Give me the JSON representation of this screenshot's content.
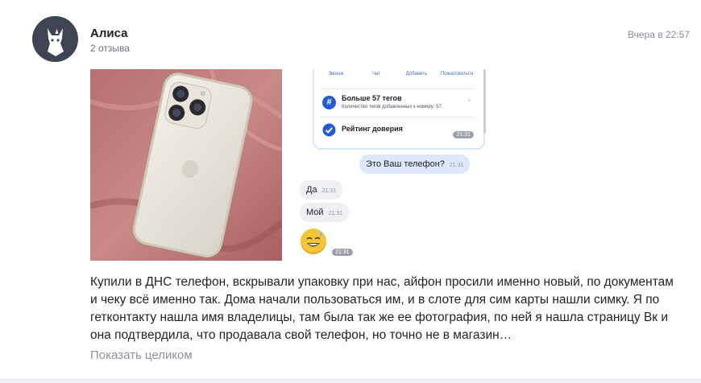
{
  "author": {
    "name": "Алиса",
    "reviews_count": "2 отзыва",
    "avatar_icon": "fox-avatar-icon"
  },
  "review": {
    "date": "Вчера в 22:57",
    "text": "Купили в ДНС телефон, вскрывали упаковку при нас, айфон просили именно новый, по документам и чеку всё именно так. Дома начали пользоваться им, и в слоте для сим карты нашли симку. Я по гетконтакту нашла имя владелицы, там была так же ее фотография, по ней я нашла страницу Вк и она подтвердила, что продавала свой телефон, но точно не в магазин…",
    "show_more": "Показать целиком"
  },
  "screenshot": {
    "actions": [
      {
        "label": "Звонок",
        "icon": "phone-icon"
      },
      {
        "label": "Чат",
        "icon": "chat-icon"
      },
      {
        "label": "Добавить",
        "icon": "add-contact-icon"
      },
      {
        "label": "Пожаловаться",
        "icon": "report-icon"
      }
    ],
    "tags_title": "Больше 57 тегов",
    "tags_sub": "Количество тегов добавленных к номеру: 57.",
    "trust_title": "Рейтинг доверия",
    "trust_time": "21:31",
    "messages": [
      {
        "text": "Это Ваш телефон?",
        "time": "21:31",
        "side": "out"
      },
      {
        "text": "Да",
        "time": "21:31",
        "side": "in"
      },
      {
        "text": "Мой",
        "time": "21:31",
        "side": "in"
      }
    ],
    "emoji_time": "21:31"
  },
  "colors": {
    "avatar_bg": "#3f4453",
    "link_gray": "#8e929c",
    "accent_blue": "#1f5bd6"
  }
}
